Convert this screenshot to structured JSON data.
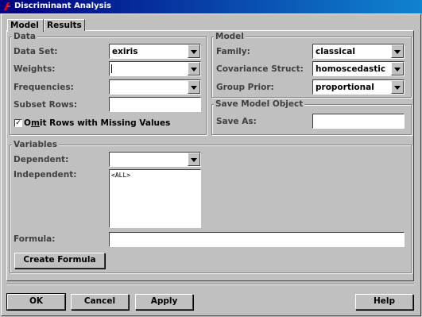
{
  "window": {
    "title": "Discriminant Analysis"
  },
  "tabs": [
    {
      "label": "Model",
      "active": true
    },
    {
      "label": "Results",
      "active": false
    }
  ],
  "data_group": {
    "title": "Data",
    "data_set": {
      "label_pre": "Data Set:",
      "value": "exiris"
    },
    "weights": {
      "label": "Weights:",
      "value": ""
    },
    "frequencies": {
      "label": "Frequencies:",
      "value": ""
    },
    "subset_rows": {
      "label": "Subset Rows:",
      "value": ""
    },
    "omit_rows": {
      "label_pre": "O",
      "label_key": "m",
      "label_post": "it Rows with Missing Values",
      "checked": true,
      "mark": "✓"
    }
  },
  "model_group": {
    "title": "Model",
    "family": {
      "label": "Family:",
      "value": "classical"
    },
    "covariance": {
      "label": "Covariance Struct:",
      "value": "homoscedastic"
    },
    "group_prior": {
      "label": "Group Prior:",
      "value": "proportional"
    }
  },
  "save_group": {
    "title": "Save Model Object",
    "save_as": {
      "label": "Save As:",
      "value": ""
    }
  },
  "variables_group": {
    "title": "Variables",
    "dependent": {
      "label": "Dependent:",
      "value": ""
    },
    "independent": {
      "label": "Independent:",
      "items": [
        "<ALL>"
      ]
    },
    "formula": {
      "label": "Formula:",
      "value": ""
    },
    "create_formula": "Create Formula"
  },
  "buttons": {
    "ok": "OK",
    "cancel": "Cancel",
    "apply": "Apply",
    "help": "Help"
  },
  "colors": {
    "titlebar_start": "#000080",
    "titlebar_end": "#1084d0",
    "face": "#c0c0c0",
    "label": "#404040"
  }
}
